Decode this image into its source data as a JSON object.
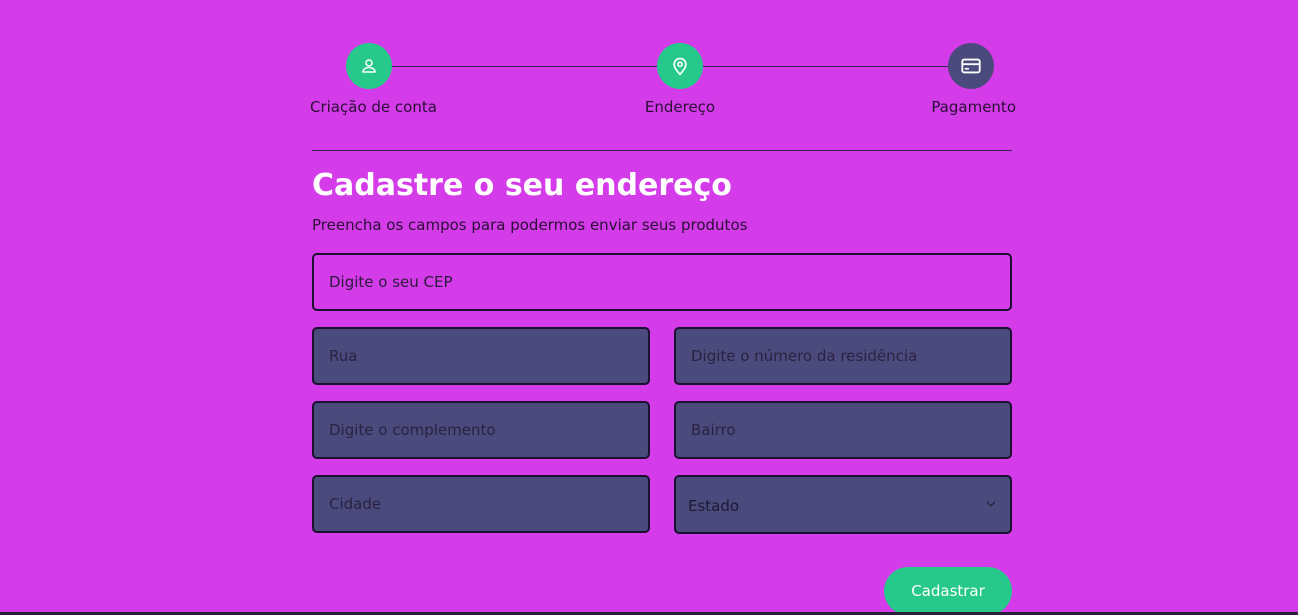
{
  "stepper": {
    "steps": [
      {
        "label": "Criação de conta",
        "icon": "user-icon",
        "status": "done"
      },
      {
        "label": "Endereço",
        "icon": "map-pin-icon",
        "status": "done"
      },
      {
        "label": "Pagamento",
        "icon": "credit-card-icon",
        "status": "pending"
      }
    ]
  },
  "form": {
    "title": "Cadastre o seu endereço",
    "subtitle": "Preencha os campos para podermos enviar seus produtos",
    "cep_placeholder": "Digite o seu CEP",
    "street_placeholder": "Rua",
    "number_placeholder": "Digite o número da residência",
    "complement_placeholder": "Digite o complemento",
    "neighborhood_placeholder": "Bairro",
    "city_placeholder": "Cidade",
    "state_selected": "Estado",
    "submit_label": "Cadastrar"
  },
  "colors": {
    "background": "#d43be9",
    "accent": "#27c98a",
    "pending_step": "#4a4a7c",
    "input_filled": "#4a4a7c",
    "title_text": "#ffffff"
  }
}
